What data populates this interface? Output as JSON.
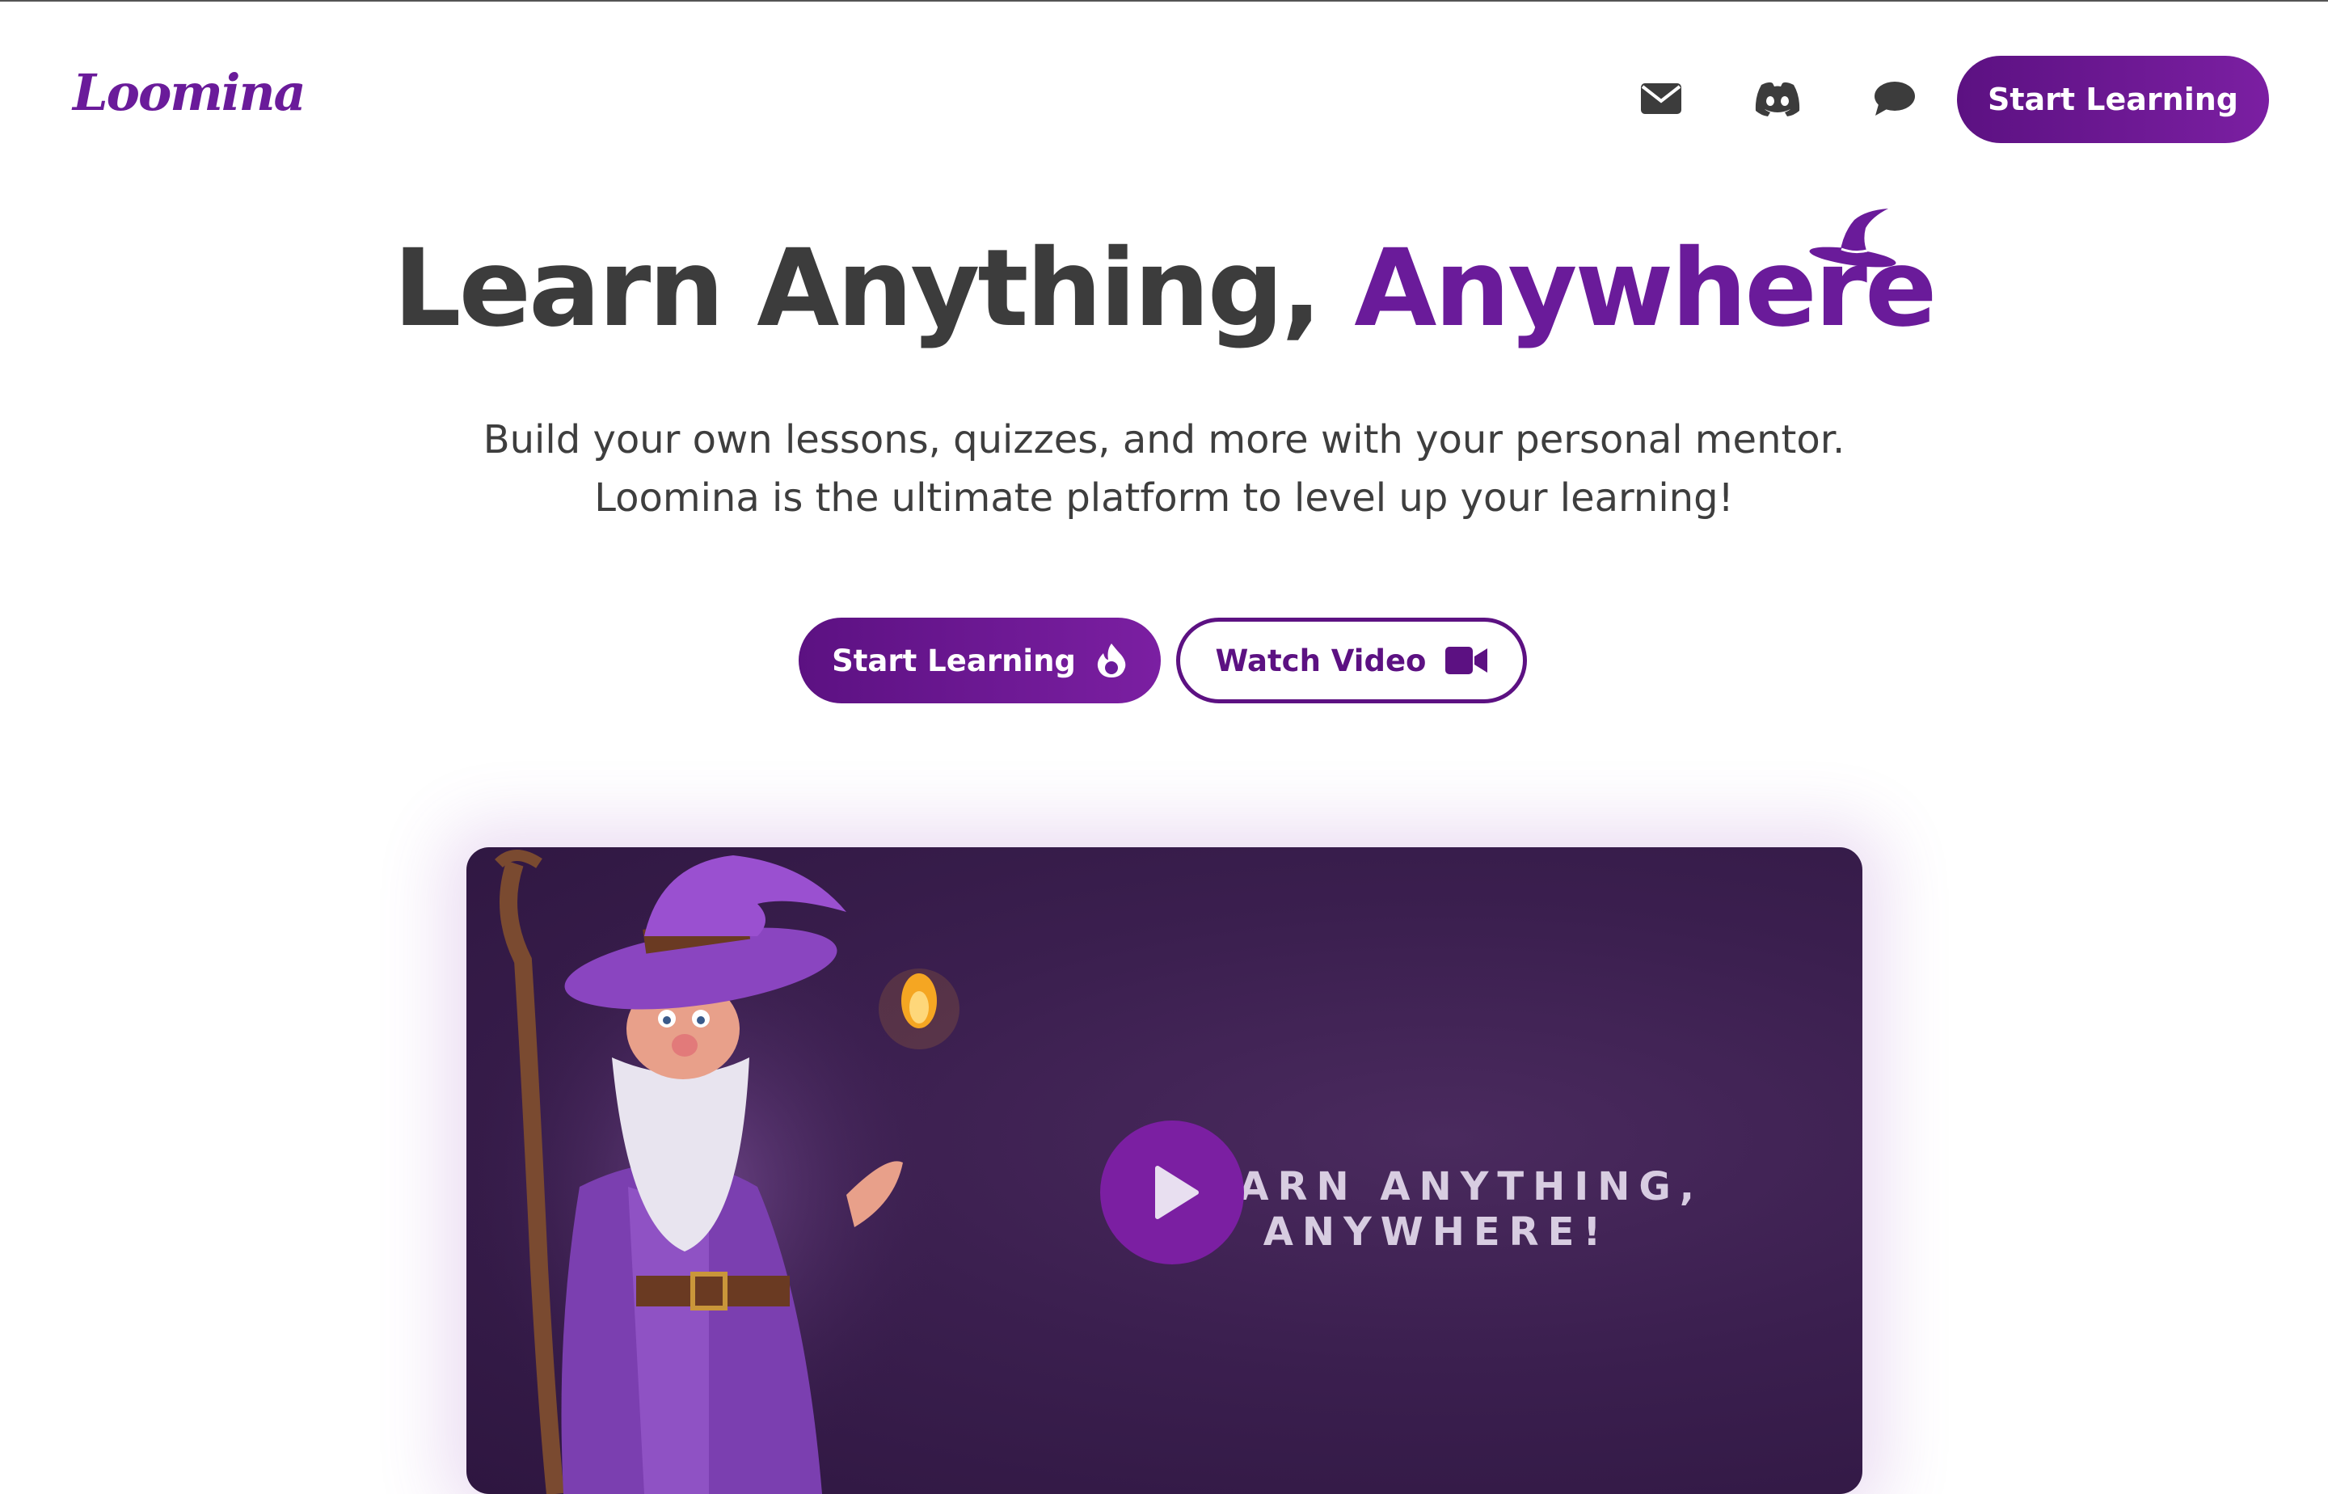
{
  "header": {
    "logo_text": "Loomina",
    "icons": [
      "envelope-icon",
      "discord-icon",
      "chat-bubble-icon"
    ],
    "cta_label": "Start Learning"
  },
  "hero": {
    "title_main": "Learn Anything, ",
    "title_accent": "Anywhere",
    "subtitle_line1": "Build your own lessons, quizzes, and more with your personal mentor.",
    "subtitle_line2": "Loomina is the ultimate platform to level up your learning!",
    "primary_button": "Start Learning",
    "secondary_button": "Watch Video"
  },
  "video": {
    "overlay_text": "LEARN ANYTHING, ANYWHERE!"
  },
  "colors": {
    "brand_purple": "#6a1b9a",
    "brand_dark": "#5c1182",
    "text": "#3c3c3c"
  }
}
